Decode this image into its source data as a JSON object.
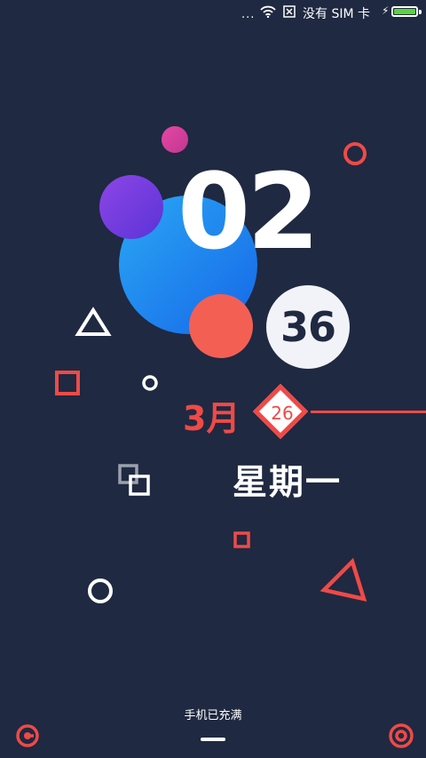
{
  "status_bar": {
    "dots": "...",
    "carrier_text": "没有 SIM 卡",
    "battery_color": "#5fd23a"
  },
  "clock": {
    "hour": "02",
    "minute": "36"
  },
  "date": {
    "month": "3月",
    "day": "26",
    "weekday": "星期一"
  },
  "footer": {
    "charging_text": "手机已充满"
  },
  "colors": {
    "background": "#1f2941",
    "accent_red": "#ef4a47",
    "blue_ball": "#1f8ff0",
    "purple_ball": "#7a3fe0",
    "magenta_ball": "#d83e9e",
    "coral_ball": "#f45f54"
  },
  "icons": [
    "more-dots-icon",
    "wifi-icon",
    "no-sim-icon",
    "charging-bolt-icon",
    "battery-icon",
    "camera-shortcut-icon",
    "target-shortcut-icon"
  ]
}
